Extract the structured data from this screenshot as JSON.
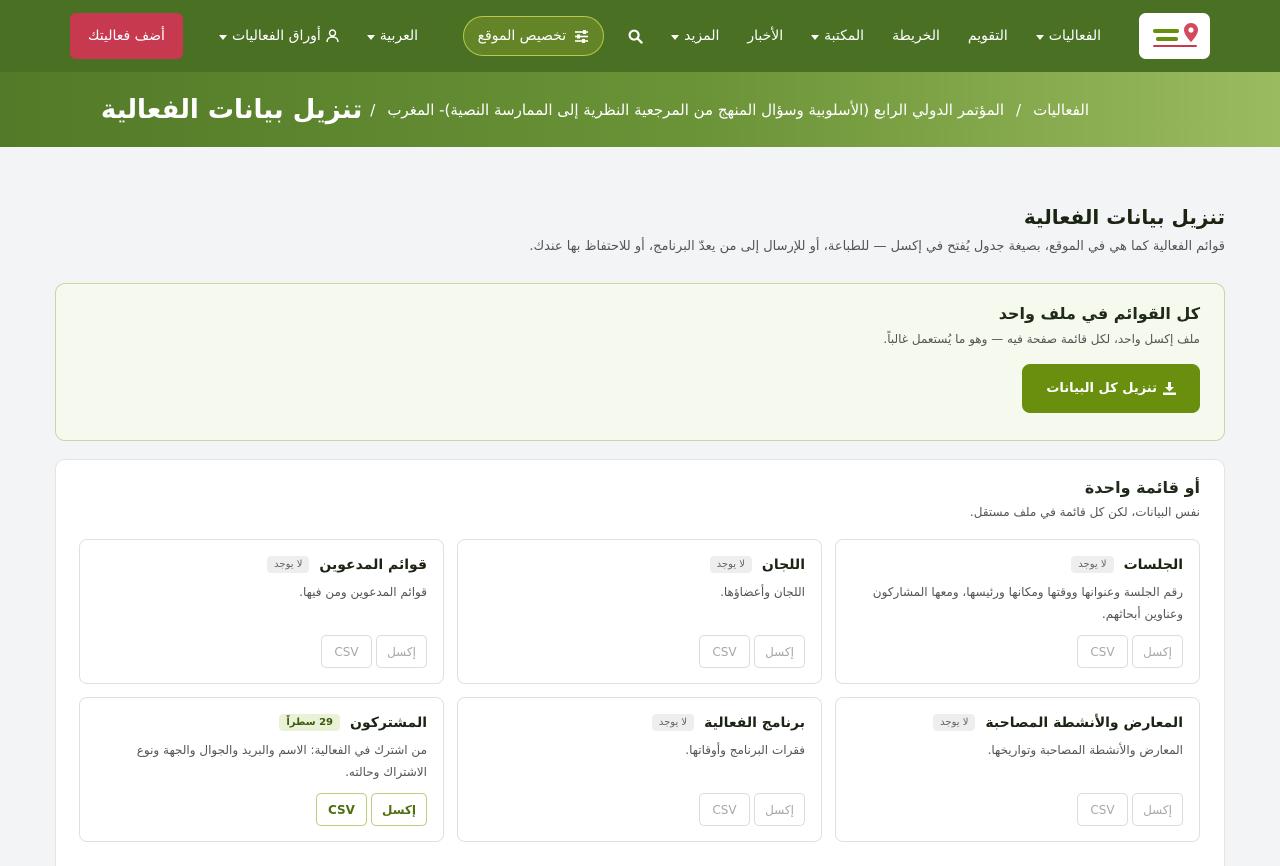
{
  "nav": {
    "logo_text": "أوراق الفعاليات",
    "links": [
      {
        "label": "الفعاليات",
        "dropdown": true
      },
      {
        "label": "التقويم",
        "dropdown": false
      },
      {
        "label": "الخريطة",
        "dropdown": false
      },
      {
        "label": "المكتبة",
        "dropdown": true
      },
      {
        "label": "الأخبار",
        "dropdown": false
      },
      {
        "label": "المزيد",
        "dropdown": true
      }
    ],
    "customize_label": "تخصيص الموقع",
    "language_label": "العربية",
    "account_label": "أوراق الفعاليات",
    "add_event_label": "أضف فعاليتك"
  },
  "breadcrumb": {
    "root": "الفعاليات",
    "event": "المؤتمر الدولي الرابع (الأسلوبية وسؤال المنهج من المرجعية النظرية إلى الممارسة النصية)- المغرب",
    "current": "تنزيل بيانات الفعالية"
  },
  "main": {
    "heading": "تنزيل بيانات الفعالية",
    "subheading": "قوائم الفعالية كما هي في الموقع، بصيغة جدول يُفتح في إكسل — للطباعة، أو للإرسال إلى من يعدّ البرنامج، أو للاحتفاظ بها عندك.",
    "all_in_one": {
      "title": "كل القوائم في ملف واحد",
      "subtitle": "ملف إكسل واحد، لكل قائمة صفحة فيه — وهو ما يُستعمل غالباً.",
      "button": "تنزيل كل البيانات"
    },
    "single": {
      "title": "أو قائمة واحدة",
      "subtitle": "نفس البيانات، لكن كل قائمة في ملف مستقل.",
      "excel_label": "إكسل",
      "csv_label": "CSV",
      "items": [
        {
          "name": "الجلسات",
          "badge": "لا يوجد",
          "desc": "رقم الجلسة وعنوانها ووقتها ومكانها ورئيسها، ومعها المشاركون وعناوين أبحاثهم."
        },
        {
          "name": "اللجان",
          "badge": "لا يوجد",
          "desc": "اللجان وأعضاؤها."
        },
        {
          "name": "قوائم المدعوين",
          "badge": "لا يوجد",
          "desc": "قوائم المدعوين ومن فيها."
        },
        {
          "name": "المعارض والأنشطة المصاحبة",
          "badge": "لا يوجد",
          "desc": "المعارض والأنشطة المصاحبة وتواريخها."
        },
        {
          "name": "برنامج الفعالية",
          "badge": "لا يوجد",
          "desc": "فقرات البرنامج وأوقاتها."
        },
        {
          "name": "المشتركون",
          "badge": "29 سطراً",
          "desc": "من اشترك في الفعالية: الاسم والبريد والجوال والجهة ونوع الاشتراك وحالته."
        }
      ]
    }
  },
  "colors": {
    "navbar": "#4a7024",
    "accent_button": "#6a8f0e",
    "add_event": "#c6394f"
  }
}
